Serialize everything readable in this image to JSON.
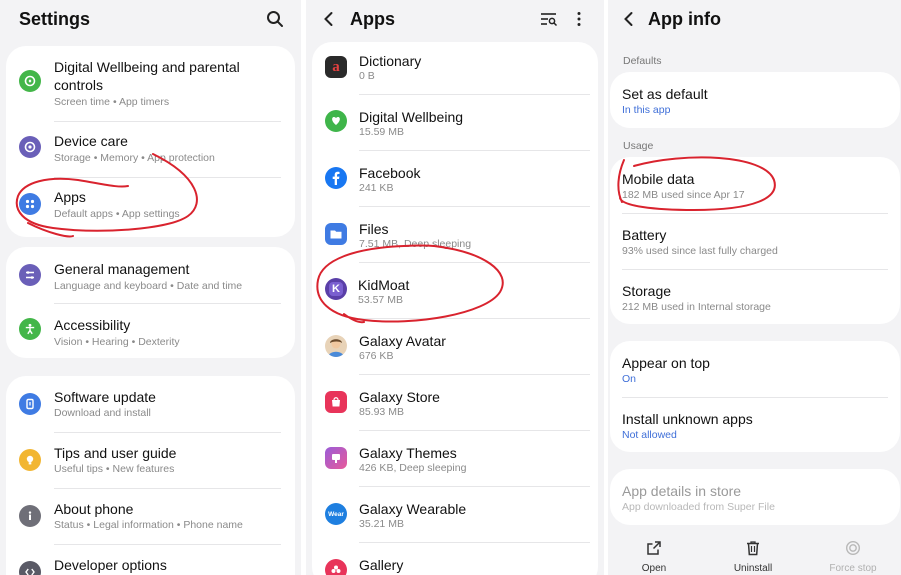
{
  "settings": {
    "title": "Settings",
    "card1": [
      {
        "title": "Digital Wellbeing and parental",
        "title2": "controls",
        "sub": "Screen time  •  App timers",
        "icon": "digital-wellbeing-icon",
        "color": "#43b649"
      },
      {
        "title": "Device care",
        "sub": "Storage  •  Memory  •  App protection",
        "icon": "device-care-icon",
        "color": "#6a5fb8"
      },
      {
        "title": "Apps",
        "sub": "Default apps  •  App settings",
        "icon": "apps-icon",
        "color": "#3f7be3"
      }
    ],
    "card2": [
      {
        "title": "General management",
        "sub": "Language and keyboard  •  Date and time",
        "icon": "general-management-icon",
        "color": "#6a5fb8"
      },
      {
        "title": "Accessibility",
        "sub": "Vision  •  Hearing  •  Dexterity",
        "icon": "accessibility-icon",
        "color": "#43b649"
      }
    ],
    "card3": [
      {
        "title": "Software update",
        "sub": "Download and install",
        "icon": "software-update-icon",
        "color": "#3f7be3"
      },
      {
        "title": "Tips and user guide",
        "sub": "Useful tips  •  New features",
        "icon": "tips-icon",
        "color": "#f2b632"
      },
      {
        "title": "About phone",
        "sub": "Status  •  Legal information  •  Phone name",
        "icon": "about-phone-icon",
        "color": "#6f6f78"
      },
      {
        "title": "Developer options",
        "icon": "developer-options-icon",
        "color": "#5a5a66"
      }
    ]
  },
  "apps": {
    "title": "Apps",
    "list": [
      {
        "name": "Dictionary",
        "size": "0 B",
        "icon": "dictionary-icon"
      },
      {
        "name": "Digital Wellbeing",
        "size": "15.59 MB",
        "icon": "digital-wellbeing-app-icon"
      },
      {
        "name": "Facebook",
        "size": "241 KB",
        "icon": "facebook-icon"
      },
      {
        "name": "Files",
        "size": "7.51 MB, Deep sleeping",
        "icon": "files-icon"
      },
      {
        "name": "KidMoat",
        "size": "53.57 MB",
        "icon": "kidmoat-icon"
      },
      {
        "name": "Galaxy Avatar",
        "size": "676 KB",
        "icon": "galaxy-avatar-icon"
      },
      {
        "name": "Galaxy Store",
        "size": "85.93 MB",
        "icon": "galaxy-store-icon"
      },
      {
        "name": "Galaxy Themes",
        "size": "426 KB, Deep sleeping",
        "icon": "galaxy-themes-icon"
      },
      {
        "name": "Galaxy Wearable",
        "size": "35.21 MB",
        "icon": "galaxy-wearable-icon"
      },
      {
        "name": "Gallery",
        "size": "",
        "icon": "gallery-icon"
      }
    ]
  },
  "appinfo": {
    "title": "App info",
    "defaults_label": "Defaults",
    "set_as_default": {
      "title": "Set as default",
      "sub": "In this app"
    },
    "usage_label": "Usage",
    "mobile_data": {
      "title": "Mobile data",
      "sub": "182 MB used since Apr 17"
    },
    "battery": {
      "title": "Battery",
      "sub": "93% used since last fully charged"
    },
    "storage": {
      "title": "Storage",
      "sub": "212 MB used in Internal storage"
    },
    "appear_on_top": {
      "title": "Appear on top",
      "sub": "On"
    },
    "install_unknown": {
      "title": "Install unknown apps",
      "sub": "Not allowed"
    },
    "app_details": {
      "title": "App details in store",
      "sub": "App downloaded from Super File"
    },
    "bottom": {
      "open": "Open",
      "uninstall": "Uninstall",
      "force_stop": "Force stop"
    }
  },
  "wear_glyph": "Wear",
  "dictionary_glyph": "a",
  "kidmoat_glyph": "K",
  "accent_red": "#d9232e"
}
